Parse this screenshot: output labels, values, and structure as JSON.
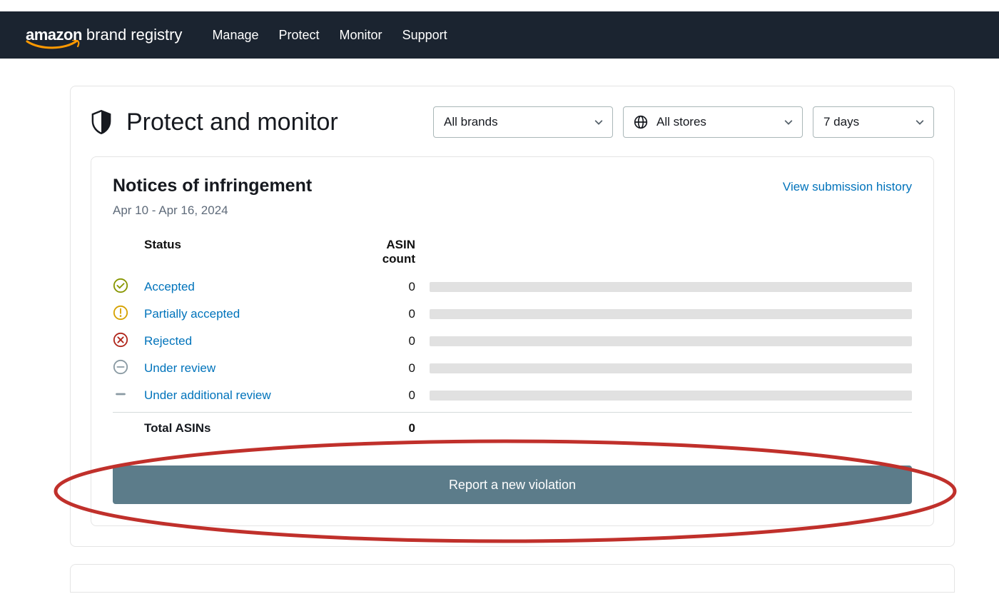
{
  "header": {
    "logo_primary": "amazon",
    "logo_secondary": "brand registry",
    "nav": [
      "Manage",
      "Protect",
      "Monitor",
      "Support"
    ]
  },
  "page": {
    "title": "Protect and monitor",
    "filters": {
      "brands": "All brands",
      "stores": "All stores",
      "range": "7 days"
    }
  },
  "panel": {
    "title": "Notices of infringement",
    "date_range": "Apr 10 - Apr 16, 2024",
    "history_link": "View submission history",
    "columns": {
      "status": "Status",
      "count": "ASIN count"
    },
    "rows": [
      {
        "icon": "check-circle",
        "label": "Accepted",
        "count": 0
      },
      {
        "icon": "alert-circle",
        "label": "Partially accepted",
        "count": 0
      },
      {
        "icon": "x-circle",
        "label": "Rejected",
        "count": 0
      },
      {
        "icon": "minus-circle",
        "label": "Under review",
        "count": 0
      },
      {
        "icon": "minus",
        "label": "Under additional review",
        "count": 0
      }
    ],
    "total_label": "Total ASINs",
    "total_count": 0,
    "report_button": "Report a new violation"
  }
}
